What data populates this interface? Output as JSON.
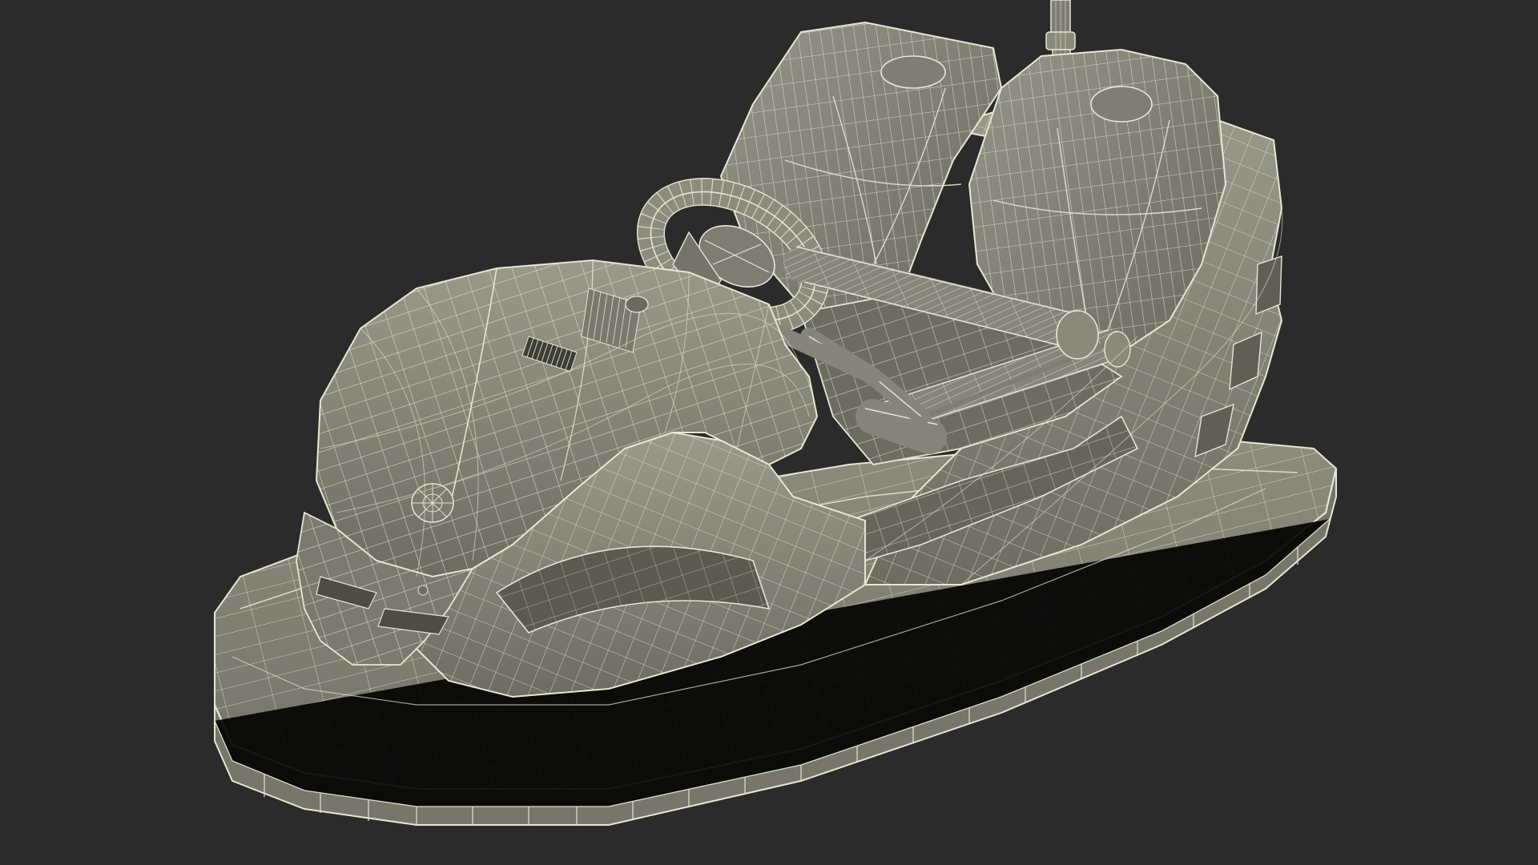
{
  "scene": {
    "subject": "bumper-car",
    "render_style": "wireframe",
    "colors": {
      "background": "#2b2b2b",
      "body_fill": "#8a8a7c",
      "body_shade": "#6e6e62",
      "body_dark": "#55554b",
      "body_light": "#9c9c8e",
      "wire": "#e6e6d2",
      "wire_faint": "#cfcfbb"
    }
  }
}
